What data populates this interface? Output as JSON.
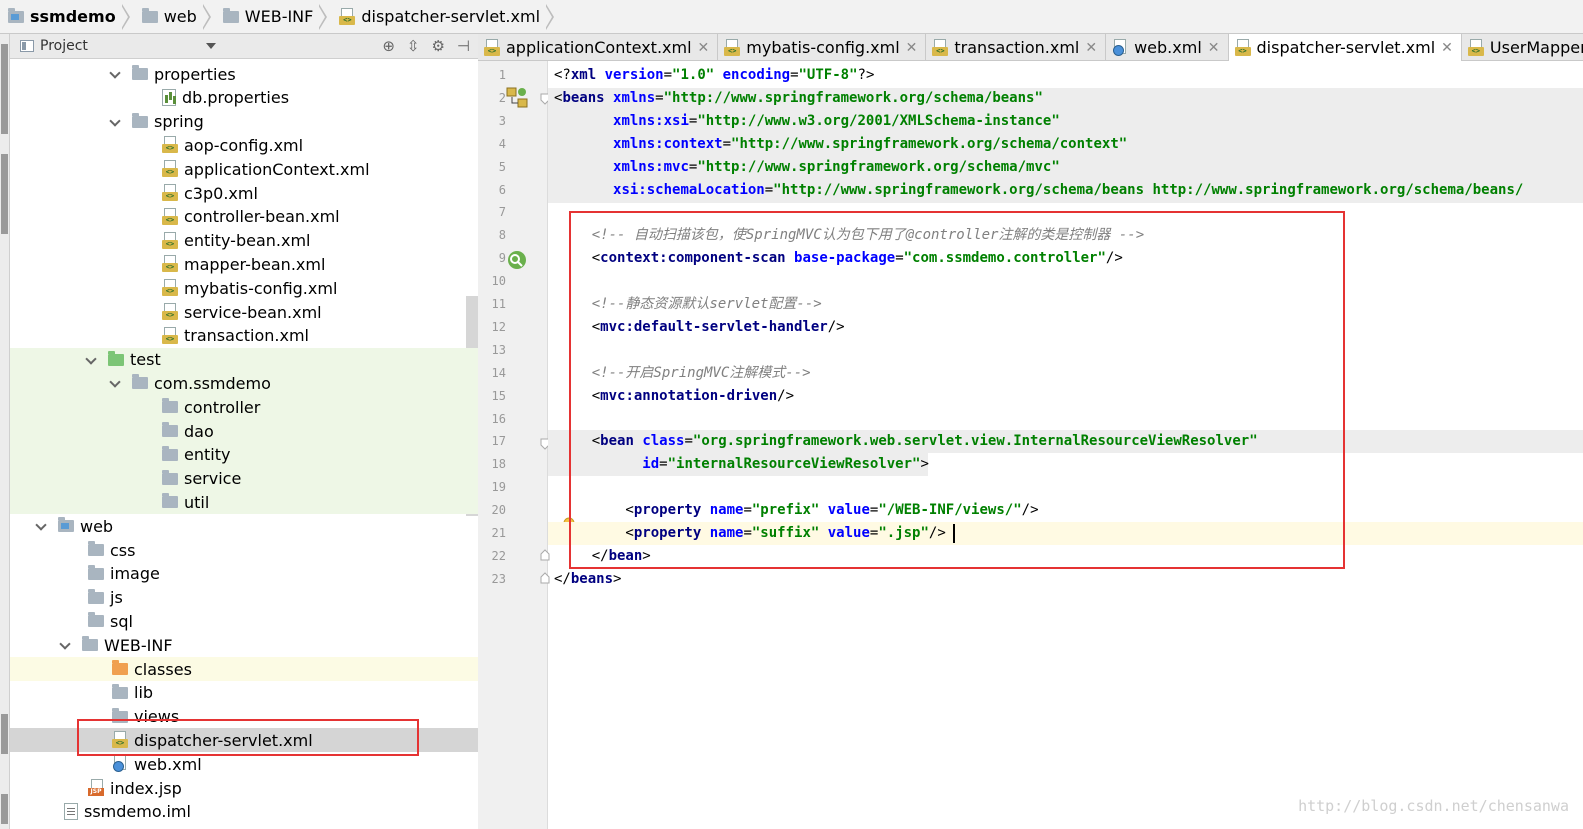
{
  "breadcrumb": [
    "ssmdemo",
    "web",
    "WEB-INF",
    "dispatcher-servlet.xml"
  ],
  "project_panel": {
    "title": "Project",
    "tree": [
      {
        "label": "properties",
        "type": "folder",
        "expanded": true
      },
      {
        "label": "db.properties",
        "type": "props"
      },
      {
        "label": "spring",
        "type": "folder",
        "expanded": true
      },
      {
        "label": "aop-config.xml",
        "type": "xml"
      },
      {
        "label": "applicationContext.xml",
        "type": "xml"
      },
      {
        "label": "c3p0.xml",
        "type": "xml"
      },
      {
        "label": "controller-bean.xml",
        "type": "xml"
      },
      {
        "label": "entity-bean.xml",
        "type": "xml"
      },
      {
        "label": "mapper-bean.xml",
        "type": "xml"
      },
      {
        "label": "mybatis-config.xml",
        "type": "xml"
      },
      {
        "label": "service-bean.xml",
        "type": "xml"
      },
      {
        "label": "transaction.xml",
        "type": "xml"
      },
      {
        "label": "test",
        "type": "folder-green",
        "expanded": true
      },
      {
        "label": "com.ssmdemo",
        "type": "folder",
        "expanded": true
      },
      {
        "label": "controller",
        "type": "folder"
      },
      {
        "label": "dao",
        "type": "folder"
      },
      {
        "label": "entity",
        "type": "folder"
      },
      {
        "label": "service",
        "type": "folder"
      },
      {
        "label": "util",
        "type": "folder"
      },
      {
        "label": "web",
        "type": "folder-blue",
        "expanded": true
      },
      {
        "label": "css",
        "type": "folder"
      },
      {
        "label": "image",
        "type": "folder"
      },
      {
        "label": "js",
        "type": "folder"
      },
      {
        "label": "sql",
        "type": "folder"
      },
      {
        "label": "WEB-INF",
        "type": "folder",
        "expanded": true
      },
      {
        "label": "classes",
        "type": "folder-orange"
      },
      {
        "label": "lib",
        "type": "folder"
      },
      {
        "label": "views",
        "type": "folder"
      },
      {
        "label": "dispatcher-servlet.xml",
        "type": "xml",
        "selected": true
      },
      {
        "label": "web.xml",
        "type": "webxml"
      },
      {
        "label": "index.jsp",
        "type": "jsp"
      },
      {
        "label": "ssmdemo.iml",
        "type": "iml"
      }
    ]
  },
  "tabs": [
    {
      "label": "applicationContext.xml",
      "type": "xml"
    },
    {
      "label": "mybatis-config.xml",
      "type": "xml"
    },
    {
      "label": "transaction.xml",
      "type": "xml"
    },
    {
      "label": "web.xml",
      "type": "webxml"
    },
    {
      "label": "dispatcher-servlet.xml",
      "type": "xml",
      "active": true
    },
    {
      "label": "UserMapper.xml",
      "type": "xml"
    }
  ],
  "editor": {
    "line_numbers": [
      "1",
      "2",
      "3",
      "4",
      "5",
      "6",
      "7",
      "8",
      "9",
      "10",
      "11",
      "12",
      "13",
      "14",
      "15",
      "16",
      "17",
      "18",
      "19",
      "20",
      "21",
      "22",
      "23"
    ],
    "lines": [
      [
        [
          "pun",
          "<?"
        ],
        [
          "tg",
          "xml "
        ],
        [
          "at",
          "version"
        ],
        [
          "pun",
          "="
        ],
        [
          "vl",
          "\"1.0\""
        ],
        [
          "pun",
          " "
        ],
        [
          "at",
          "encoding"
        ],
        [
          "pun",
          "="
        ],
        [
          "vl",
          "\"UTF-8\""
        ],
        [
          "pun",
          "?>"
        ]
      ],
      [
        [
          "pun",
          "<"
        ],
        [
          "tg",
          "beans "
        ],
        [
          "at",
          "xmlns"
        ],
        [
          "pun",
          "="
        ],
        [
          "vl",
          "\"http://www.springframework.org/schema/beans\""
        ]
      ],
      [
        [
          "pun",
          "       "
        ],
        [
          "at",
          "xmlns:xsi"
        ],
        [
          "pun",
          "="
        ],
        [
          "vl",
          "\"http://www.w3.org/2001/XMLSchema-instance\""
        ]
      ],
      [
        [
          "pun",
          "       "
        ],
        [
          "at",
          "xmlns:context"
        ],
        [
          "pun",
          "="
        ],
        [
          "vl",
          "\"http://www.springframework.org/schema/context\""
        ]
      ],
      [
        [
          "pun",
          "       "
        ],
        [
          "at",
          "xmlns:mvc"
        ],
        [
          "pun",
          "="
        ],
        [
          "vl",
          "\"http://www.springframework.org/schema/mvc\""
        ]
      ],
      [
        [
          "pun",
          "       "
        ],
        [
          "at",
          "xsi:schemaLocation"
        ],
        [
          "pun",
          "="
        ],
        [
          "vl",
          "\"http://www.springframework.org/schema/beans http://www.springframework.org/schema/beans/"
        ]
      ],
      [],
      [
        [
          "pun",
          "    "
        ],
        [
          "cm",
          "<!-- 自动扫描该包，使SpringMVC认为包下用了@controller注解的类是控制器 -->"
        ]
      ],
      [
        [
          "pun",
          "    <"
        ],
        [
          "tg",
          "context:component-scan "
        ],
        [
          "at",
          "base-package"
        ],
        [
          "pun",
          "="
        ],
        [
          "vl",
          "\"com.ssmdemo.controller\""
        ],
        [
          "pun",
          "/>"
        ]
      ],
      [],
      [
        [
          "pun",
          "    "
        ],
        [
          "cm",
          "<!--静态资源默认servlet配置-->"
        ]
      ],
      [
        [
          "pun",
          "    <"
        ],
        [
          "tg",
          "mvc:default-servlet-handler"
        ],
        [
          "pun",
          "/>"
        ]
      ],
      [],
      [
        [
          "pun",
          "    "
        ],
        [
          "cm",
          "<!--开启SpringMVC注解模式-->"
        ]
      ],
      [
        [
          "pun",
          "    <"
        ],
        [
          "tg",
          "mvc:annotation-driven"
        ],
        [
          "pun",
          "/>"
        ]
      ],
      [],
      [
        [
          "pun",
          "    <"
        ],
        [
          "tg",
          "bean "
        ],
        [
          "at",
          "class"
        ],
        [
          "pun",
          "="
        ],
        [
          "vl",
          "\"org.springframework.web.servlet.view.InternalResourceViewResolver\""
        ]
      ],
      [
        [
          "pun",
          "          "
        ],
        [
          "at",
          "id"
        ],
        [
          "pun",
          "="
        ],
        [
          "vl",
          "\"internalResourceViewResolver\""
        ],
        [
          "pun",
          ">"
        ]
      ],
      [],
      [
        [
          "pun",
          "        <"
        ],
        [
          "tg",
          "property "
        ],
        [
          "at",
          "name"
        ],
        [
          "pun",
          "="
        ],
        [
          "vl",
          "\"prefix\""
        ],
        [
          "pun",
          " "
        ],
        [
          "at",
          "value"
        ],
        [
          "pun",
          "="
        ],
        [
          "vl",
          "\"/WEB-INF/views/\""
        ],
        [
          "pun",
          "/>"
        ]
      ],
      [
        [
          "pun",
          "        <"
        ],
        [
          "tg",
          "property "
        ],
        [
          "at",
          "name"
        ],
        [
          "pun",
          "="
        ],
        [
          "vl",
          "\"suffix\""
        ],
        [
          "pun",
          " "
        ],
        [
          "at",
          "value"
        ],
        [
          "pun",
          "="
        ],
        [
          "vl",
          "\".jsp\""
        ],
        [
          "pun",
          "/>"
        ]
      ],
      [
        [
          "pun",
          "    </"
        ],
        [
          "tg",
          "bean"
        ],
        [
          "pun",
          ">"
        ]
      ],
      [
        [
          "pun",
          "</"
        ],
        [
          "tg",
          "beans"
        ],
        [
          "pun",
          ">"
        ]
      ]
    ]
  },
  "watermark": "http://blog.csdn.net/chensanwa",
  "colors": {
    "highlight_box": "#e53333",
    "tag": "#000080",
    "attribute": "#0000ff",
    "value": "#008000",
    "comment": "#808080"
  }
}
